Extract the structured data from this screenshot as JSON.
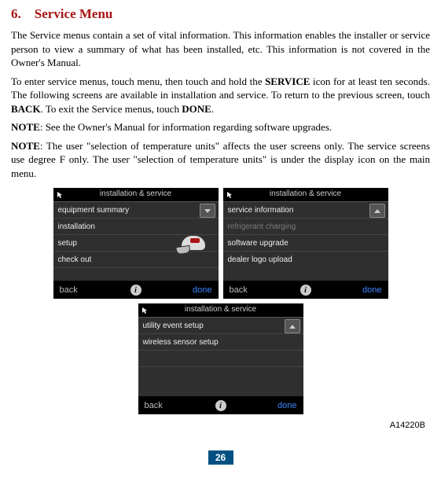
{
  "section": {
    "number": "6.",
    "title": "Service Menu"
  },
  "paragraphs": {
    "p1": "The Service menus contain a set of vital information. This information enables the installer or service person to view a summary of what has been installed, etc. This information is not covered in the Owner's Manual.",
    "p2a": "To enter service menus, touch menu, then touch and hold the ",
    "p2b": "SERVICE",
    "p2c": " icon for at least ten seconds. The following screens are available in installation and service. To return to the previous screen, touch ",
    "p2d": "BACK",
    "p2e": ". To exit the Service menus, touch ",
    "p2f": "DONE",
    "p2g": ".",
    "note1_label": "NOTE",
    "note1_text": ":  See the Owner's Manual for information regarding software upgrades.",
    "note2_label": "NOTE",
    "note2_text": ":  The user \"selection of temperature units\" affects the user screens only. The service screens use degree F only. The user \"selection of temperature units\" is under the display icon on the main menu."
  },
  "screens": [
    {
      "header": "installation & service",
      "rows": [
        "equipment summary",
        "installation",
        "setup",
        "check out"
      ],
      "dimRows": [],
      "showHat": true,
      "chip": "down"
    },
    {
      "header": "installation & service",
      "rows": [
        "service information",
        "refrigerant charging",
        "software upgrade",
        "dealer logo upload"
      ],
      "dimRows": [
        1
      ],
      "showHat": false,
      "chip": "up"
    },
    {
      "header": "installation & service",
      "rows": [
        "utility event setup",
        "wireless sensor setup",
        "",
        ""
      ],
      "dimRows": [],
      "showHat": false,
      "chip": "up"
    }
  ],
  "footer": {
    "back": "back",
    "done": "done",
    "info": "i"
  },
  "figure_caption": "A14220B",
  "page_number": "26"
}
